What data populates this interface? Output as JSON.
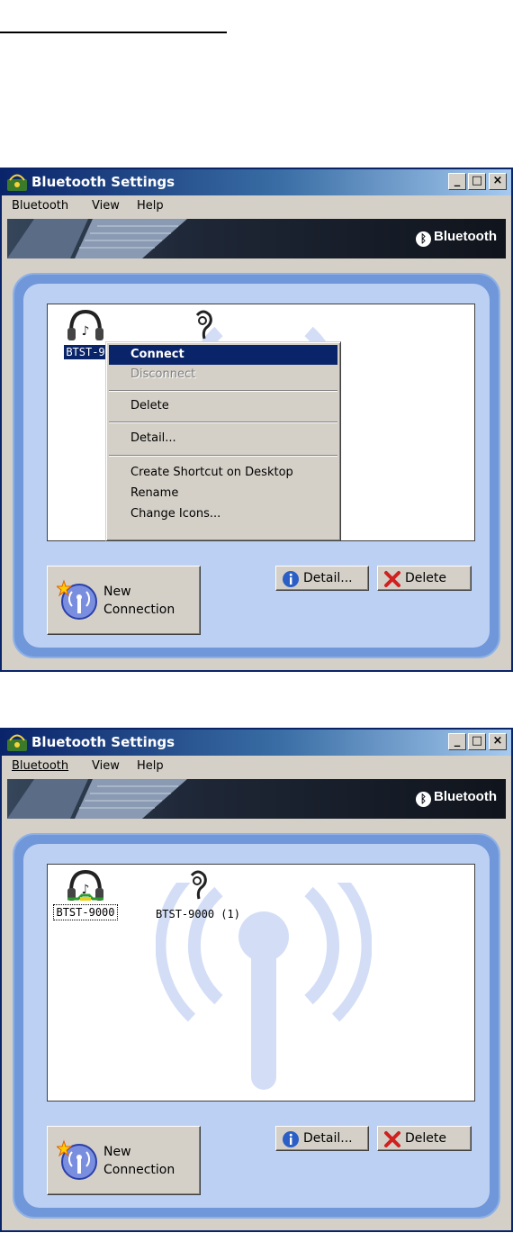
{
  "windows": [
    {
      "title": "Bluetooth Settings",
      "menu": [
        "Bluetooth",
        "View",
        "Help"
      ],
      "brand": "Bluetooth",
      "devices": [
        {
          "label": "BTST-9",
          "icon": "headset-icon",
          "state": "selected"
        },
        {
          "label": "",
          "icon": "earpiece-icon",
          "state": "normal"
        }
      ],
      "context_menu": {
        "items": [
          {
            "label": "Connect",
            "state": "highlighted"
          },
          {
            "label": "Disconnect",
            "state": "disabled"
          },
          {
            "label": "Delete",
            "state": "normal"
          },
          {
            "label": "Detail...",
            "state": "normal"
          },
          {
            "label": "Create Shortcut on Desktop",
            "state": "normal"
          },
          {
            "label": "Rename",
            "state": "normal"
          },
          {
            "label": "Change Icons...",
            "state": "normal"
          }
        ]
      },
      "buttons": {
        "new_line1": "New",
        "new_line2": "Connection",
        "detail": "Detail...",
        "delete": "Delete"
      }
    },
    {
      "title": "Bluetooth Settings",
      "menu": [
        "Bluetooth",
        "View",
        "Help"
      ],
      "brand": "Bluetooth",
      "devices": [
        {
          "label": "BTST-9000",
          "icon": "headset-connected-icon",
          "state": "focused"
        },
        {
          "label": "BTST-9000 (1)",
          "icon": "earpiece-icon",
          "state": "normal"
        }
      ],
      "buttons": {
        "new_line1": "New",
        "new_line2": "Connection",
        "detail": "Detail...",
        "delete": "Delete"
      }
    }
  ],
  "colors": {
    "title_bar": "#0a246a",
    "panel": "#6f97d9",
    "panel_inner": "#bcd0f3",
    "highlight": "#0a246a"
  }
}
